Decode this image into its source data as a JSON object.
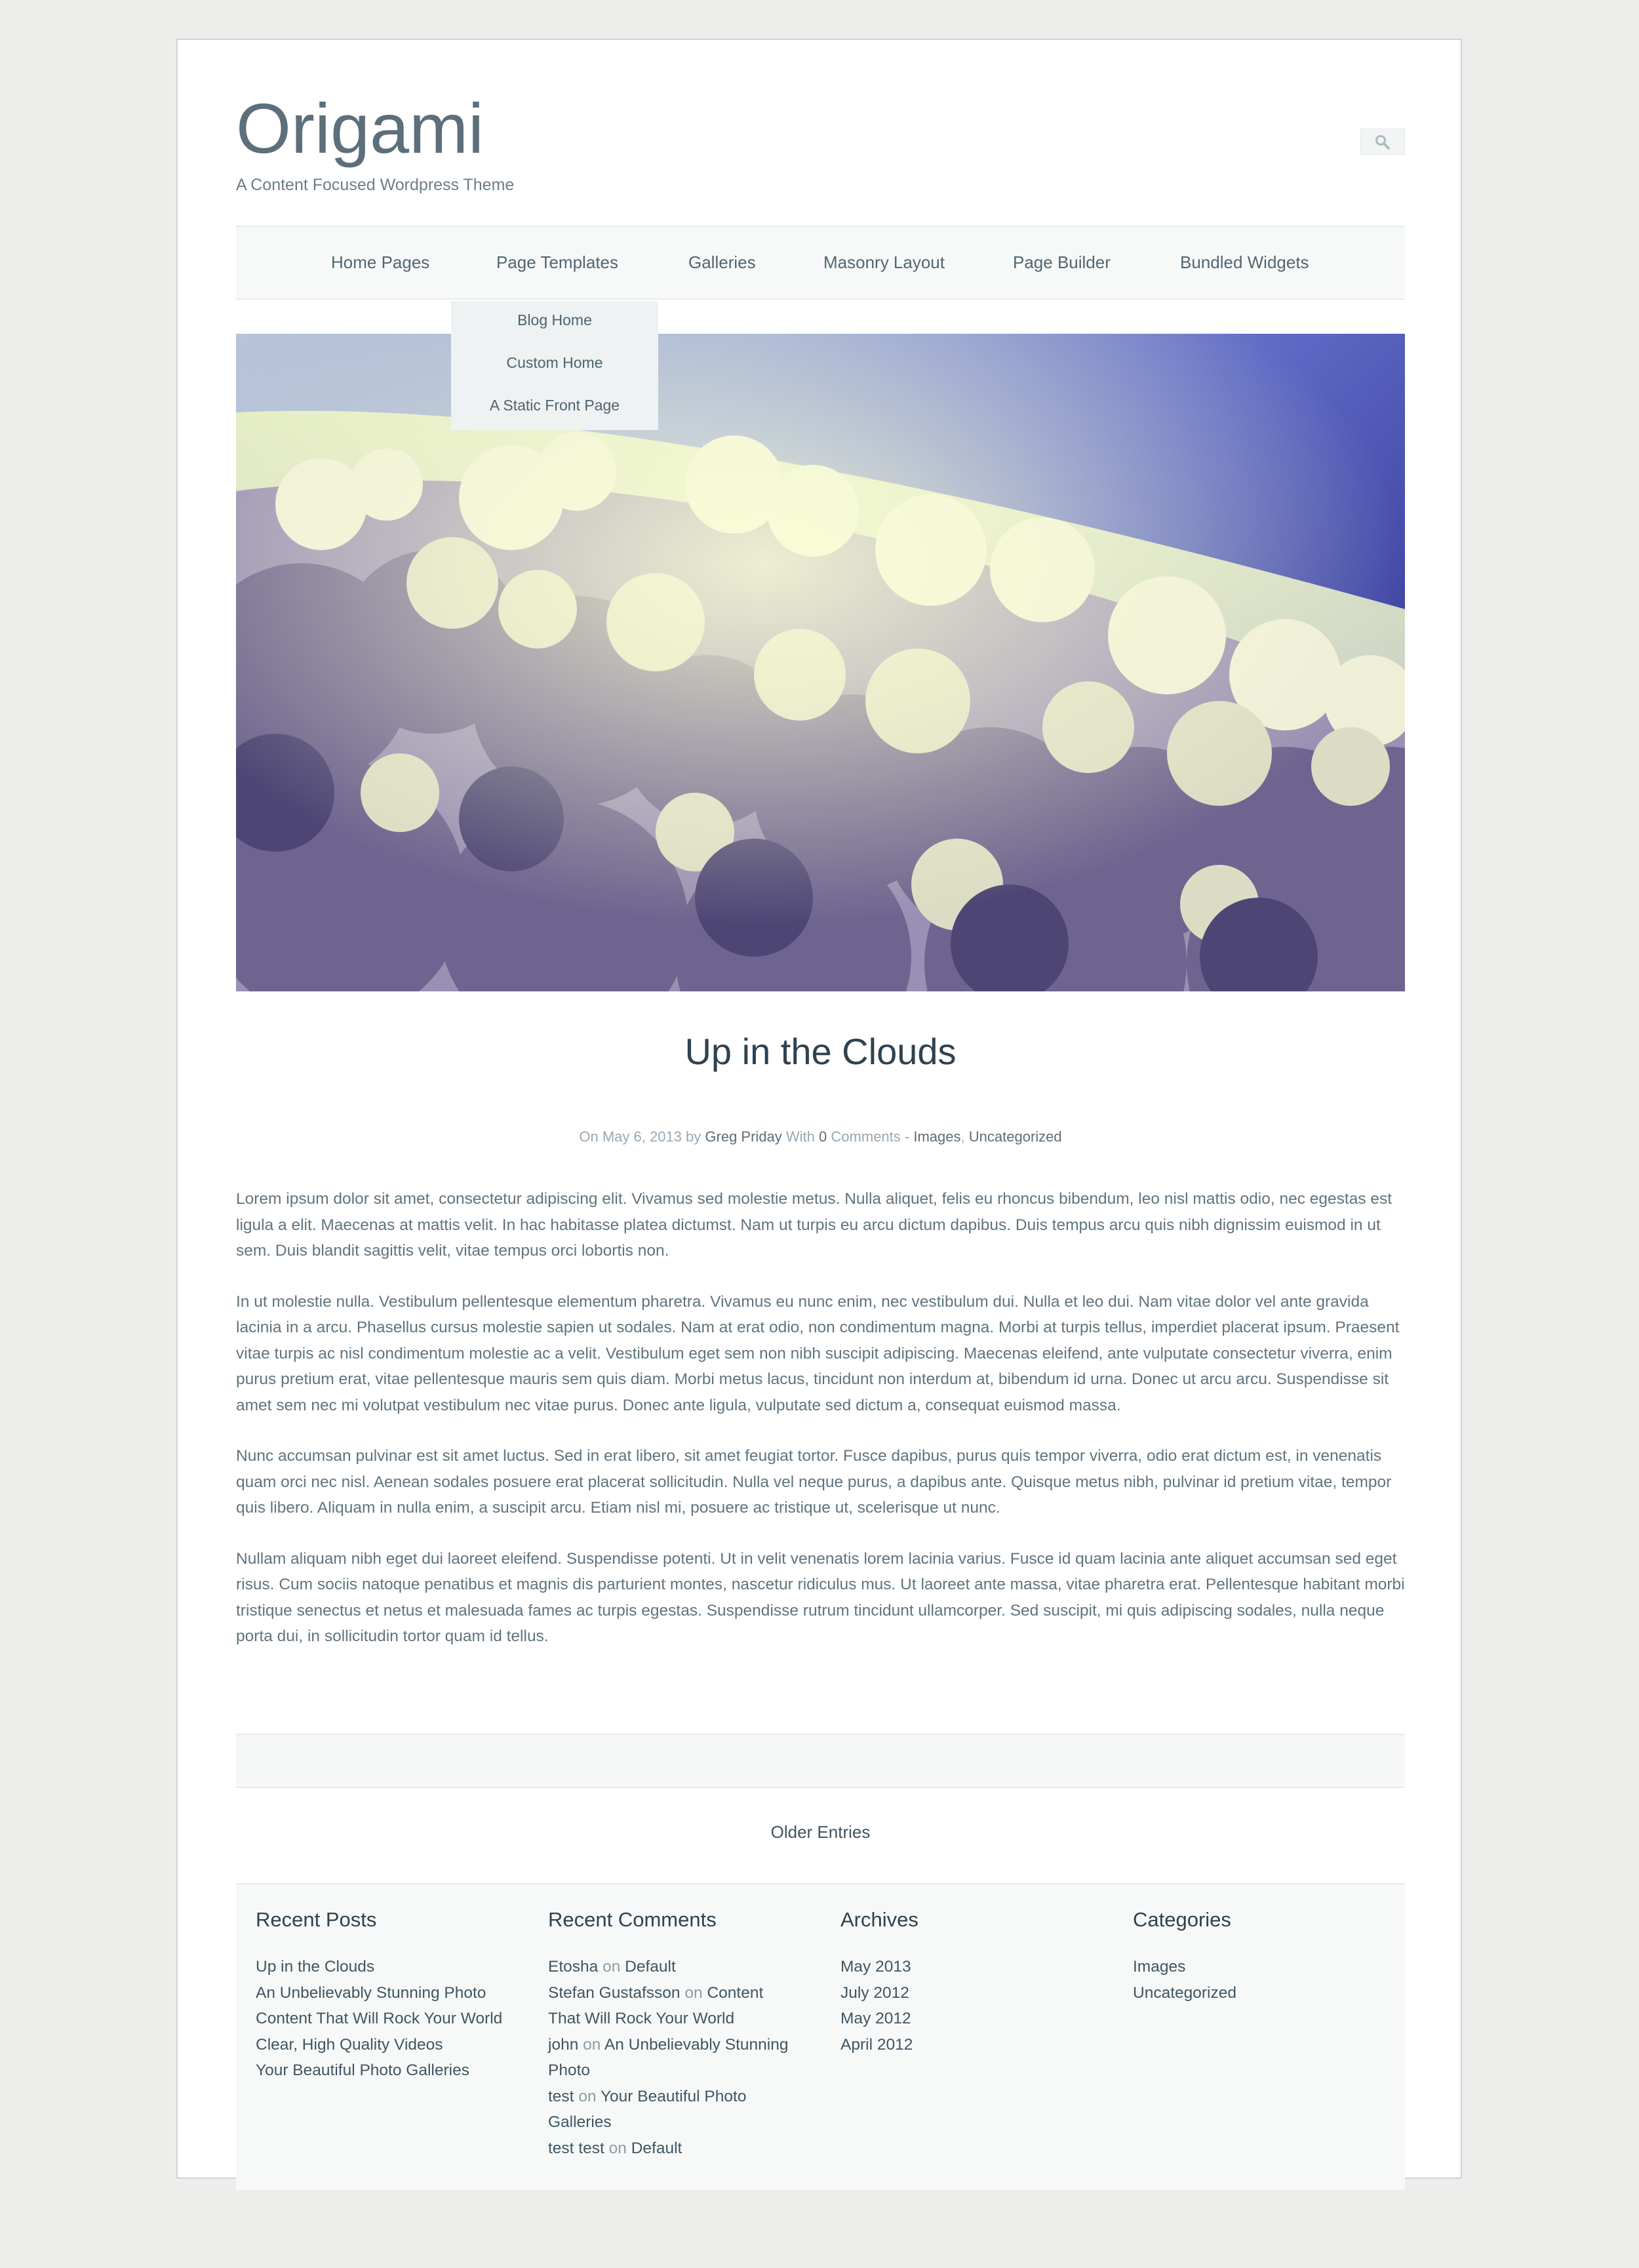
{
  "site": {
    "title": "Origami",
    "tagline": "A Content Focused Wordpress Theme"
  },
  "search": {
    "icon": "search-icon"
  },
  "nav": {
    "items": [
      "Home Pages",
      "Page Templates",
      "Galleries",
      "Masonry Layout",
      "Page Builder",
      "Bundled Widgets"
    ],
    "dropdown": [
      "Blog Home",
      "Custom Home",
      "A Static Front Page"
    ]
  },
  "post": {
    "title": "Up in the Clouds",
    "meta": {
      "on": "On",
      "date": "May 6, 2013",
      "by": "by",
      "author": "Greg Priday",
      "with": "With",
      "comment_count": "0",
      "comments_label": "Comments",
      "dash": "-",
      "category1": "Images",
      "comma": ",",
      "category2": "Uncategorized"
    },
    "paragraphs": [
      "Lorem ipsum dolor sit amet, consectetur adipiscing elit. Vivamus sed molestie metus. Nulla aliquet, felis eu rhoncus bibendum, leo nisl mattis odio, nec egestas est ligula a elit. Maecenas at mattis velit. In hac habitasse platea dictumst. Nam ut turpis eu arcu dictum dapibus. Duis tempus arcu quis nibh dignissim euismod in ut sem. Duis blandit sagittis velit, vitae tempus orci lobortis non.",
      "In ut molestie nulla. Vestibulum pellentesque elementum pharetra. Vivamus eu nunc enim, nec vestibulum dui. Nulla et leo dui. Nam vitae dolor vel ante gravida lacinia in a arcu. Phasellus cursus molestie sapien ut sodales. Nam at erat odio, non condimentum magna. Morbi at turpis tellus, imperdiet placerat ipsum. Praesent vitae turpis ac nisl condimentum molestie ac a velit. Vestibulum eget sem non nibh suscipit adipiscing. Maecenas eleifend, ante vulputate consectetur viverra, enim purus pretium erat, vitae pellentesque mauris sem quis diam. Morbi metus lacus, tincidunt non interdum at, bibendum id urna. Donec ut arcu arcu. Suspendisse sit amet sem nec mi volutpat vestibulum nec vitae purus. Donec ante ligula, vulputate sed dictum a, consequat euismod massa.",
      "Nunc accumsan pulvinar est sit amet luctus. Sed in erat libero, sit amet feugiat tortor. Fusce dapibus, purus quis tempor viverra, odio erat dictum est, in venenatis quam orci nec nisl. Aenean sodales posuere erat placerat sollicitudin. Nulla vel neque purus, a dapibus ante. Quisque metus nibh, pulvinar id pretium vitae, tempor quis libero. Aliquam in nulla enim, a suscipit arcu. Etiam nisl mi, posuere ac tristique ut, scelerisque ut nunc.",
      "Nullam aliquam nibh eget dui laoreet eleifend. Suspendisse potenti. Ut in velit venenatis lorem lacinia varius. Fusce id quam lacinia ante aliquet accumsan sed eget risus. Cum sociis natoque penatibus et magnis dis parturient montes, nascetur ridiculus mus. Ut laoreet ante massa, vitae pharetra erat. Pellentesque habitant morbi tristique senectus et netus et malesuada fames ac turpis egestas. Suspendisse rutrum tincidunt ullamcorper. Sed suscipit, mi quis adipiscing sodales, nulla neque porta dui, in sollicitudin tortor quam id tellus."
    ]
  },
  "pagination": {
    "older": "Older Entries"
  },
  "footer": {
    "recent_posts": {
      "title": "Recent Posts",
      "items": [
        "Up in the Clouds",
        "An Unbelievably Stunning Photo",
        "Content That Will Rock Your World",
        "Clear, High Quality Videos",
        "Your Beautiful Photo Galleries"
      ]
    },
    "recent_comments": {
      "title": "Recent Comments",
      "items": [
        {
          "author": "Etosha",
          "on": "on",
          "post": "Default"
        },
        {
          "author": "Stefan Gustafsson",
          "on": "on",
          "post": "Content That Will Rock Your World"
        },
        {
          "author": "john",
          "on": "on",
          "post": "An Unbelievably Stunning Photo"
        },
        {
          "author": "test",
          "on": "on",
          "post": "Your Beautiful Photo Galleries"
        },
        {
          "author": "test test",
          "on": "on",
          "post": "Default"
        }
      ]
    },
    "archives": {
      "title": "Archives",
      "items": [
        "May 2013",
        "July 2012",
        "May 2012",
        "April 2012"
      ]
    },
    "categories": {
      "title": "Categories",
      "items": [
        "Images",
        "Uncategorized"
      ]
    }
  },
  "colors": {
    "background": "#edeeeb",
    "title": "#5c6f7a",
    "text": "#60747f",
    "link": "#3f5563"
  }
}
